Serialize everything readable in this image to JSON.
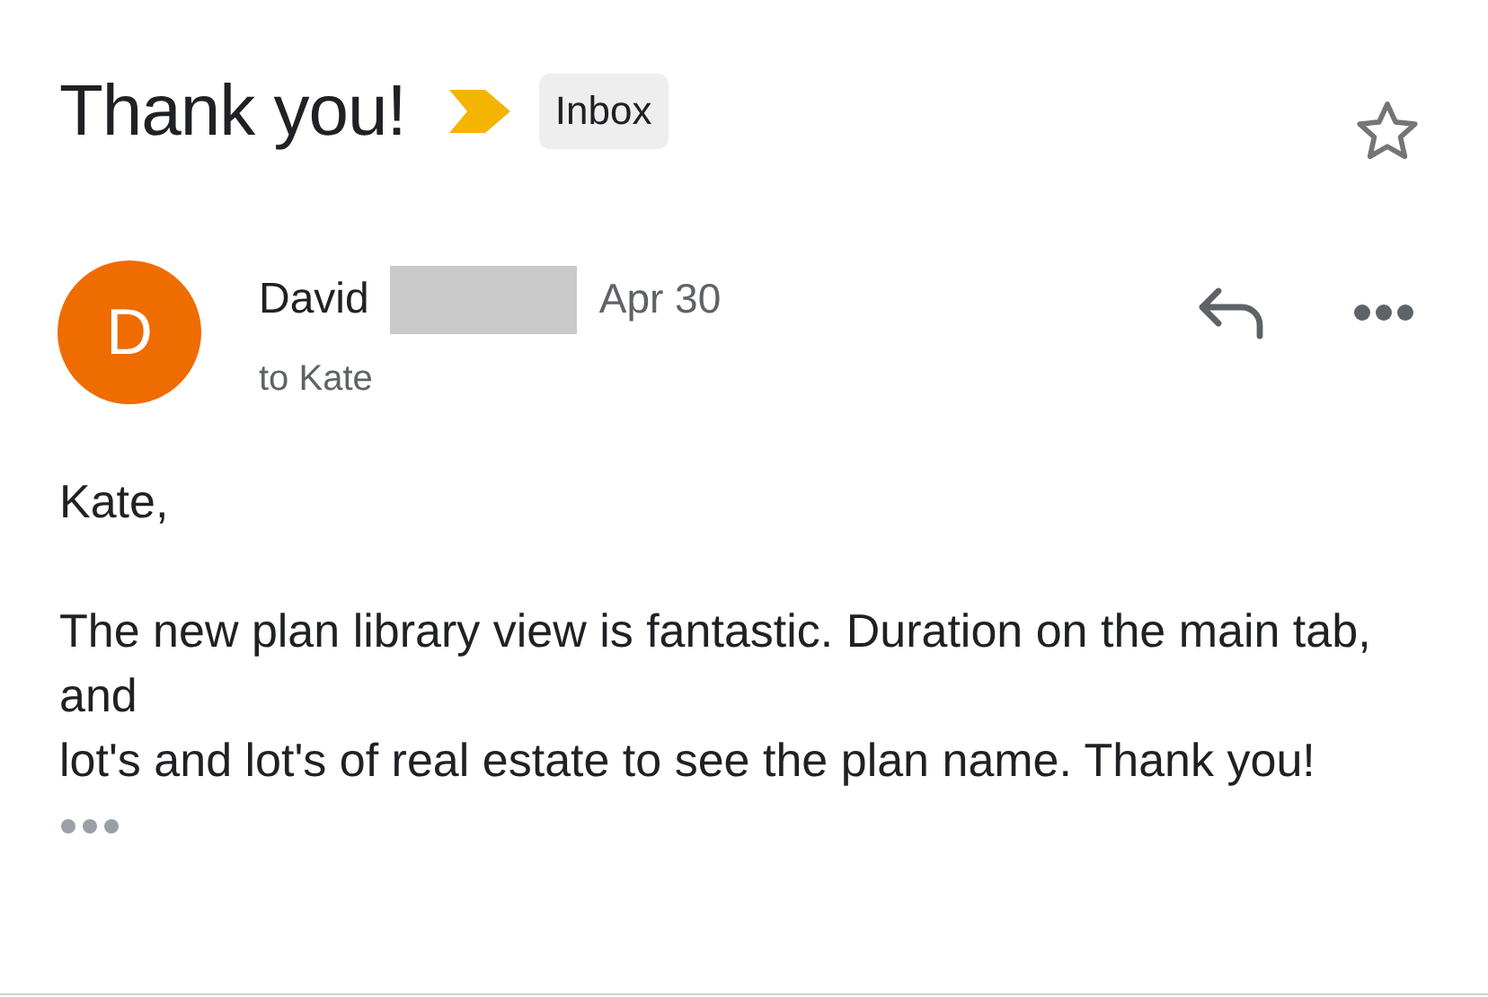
{
  "subject": "Thank you!",
  "important": true,
  "label": "Inbox",
  "starred": false,
  "sender": {
    "initial": "D",
    "color": "#ef6c00",
    "name": "David",
    "date": "Apr 30",
    "recipient": "to Kate"
  },
  "body": {
    "greeting": "Kate,",
    "lines": [
      "The new plan library view is fantastic. Duration on the main tab, and",
      "lot's and lot's of real estate to see the plan name. Thank you!"
    ]
  }
}
